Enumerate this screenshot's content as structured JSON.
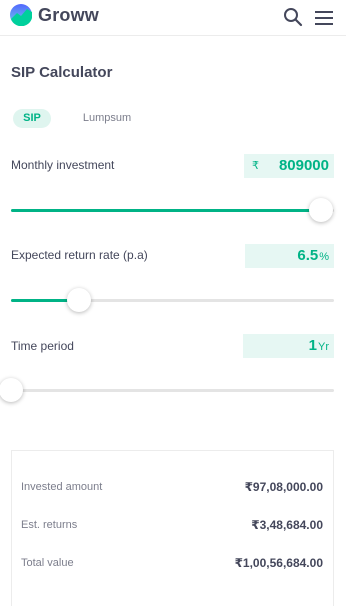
{
  "header": {
    "brand": "Groww",
    "logo_icon": "groww-logo-icon",
    "search_icon": "search-icon",
    "menu_icon": "hamburger-menu-icon"
  },
  "page": {
    "title": "SIP Calculator"
  },
  "tabs": [
    {
      "label": "SIP",
      "active": true
    },
    {
      "label": "Lumpsum",
      "active": false
    }
  ],
  "inputs": {
    "monthly_investment": {
      "label": "Monthly investment",
      "currency": "₹",
      "value": "809000",
      "slider_fraction": 0.96
    },
    "return_rate": {
      "label": "Expected return rate (p.a)",
      "value": "6.5",
      "unit": "%",
      "slider_fraction": 0.21
    },
    "time_period": {
      "label": "Time period",
      "value": "1",
      "unit": "Yr",
      "slider_fraction": 0.0
    }
  },
  "results": {
    "invested_label": "Invested amount",
    "invested_value": "₹97,08,000.00",
    "returns_label": "Est. returns",
    "returns_value": "₹3,48,684.00",
    "total_label": "Total value",
    "total_value": "₹1,00,56,684.00"
  },
  "colors": {
    "accent": "#00b386",
    "accent_bg": "#e6f7f3",
    "text": "#44475b",
    "muted": "#7c7e8c",
    "track": "#e4e4e4"
  }
}
